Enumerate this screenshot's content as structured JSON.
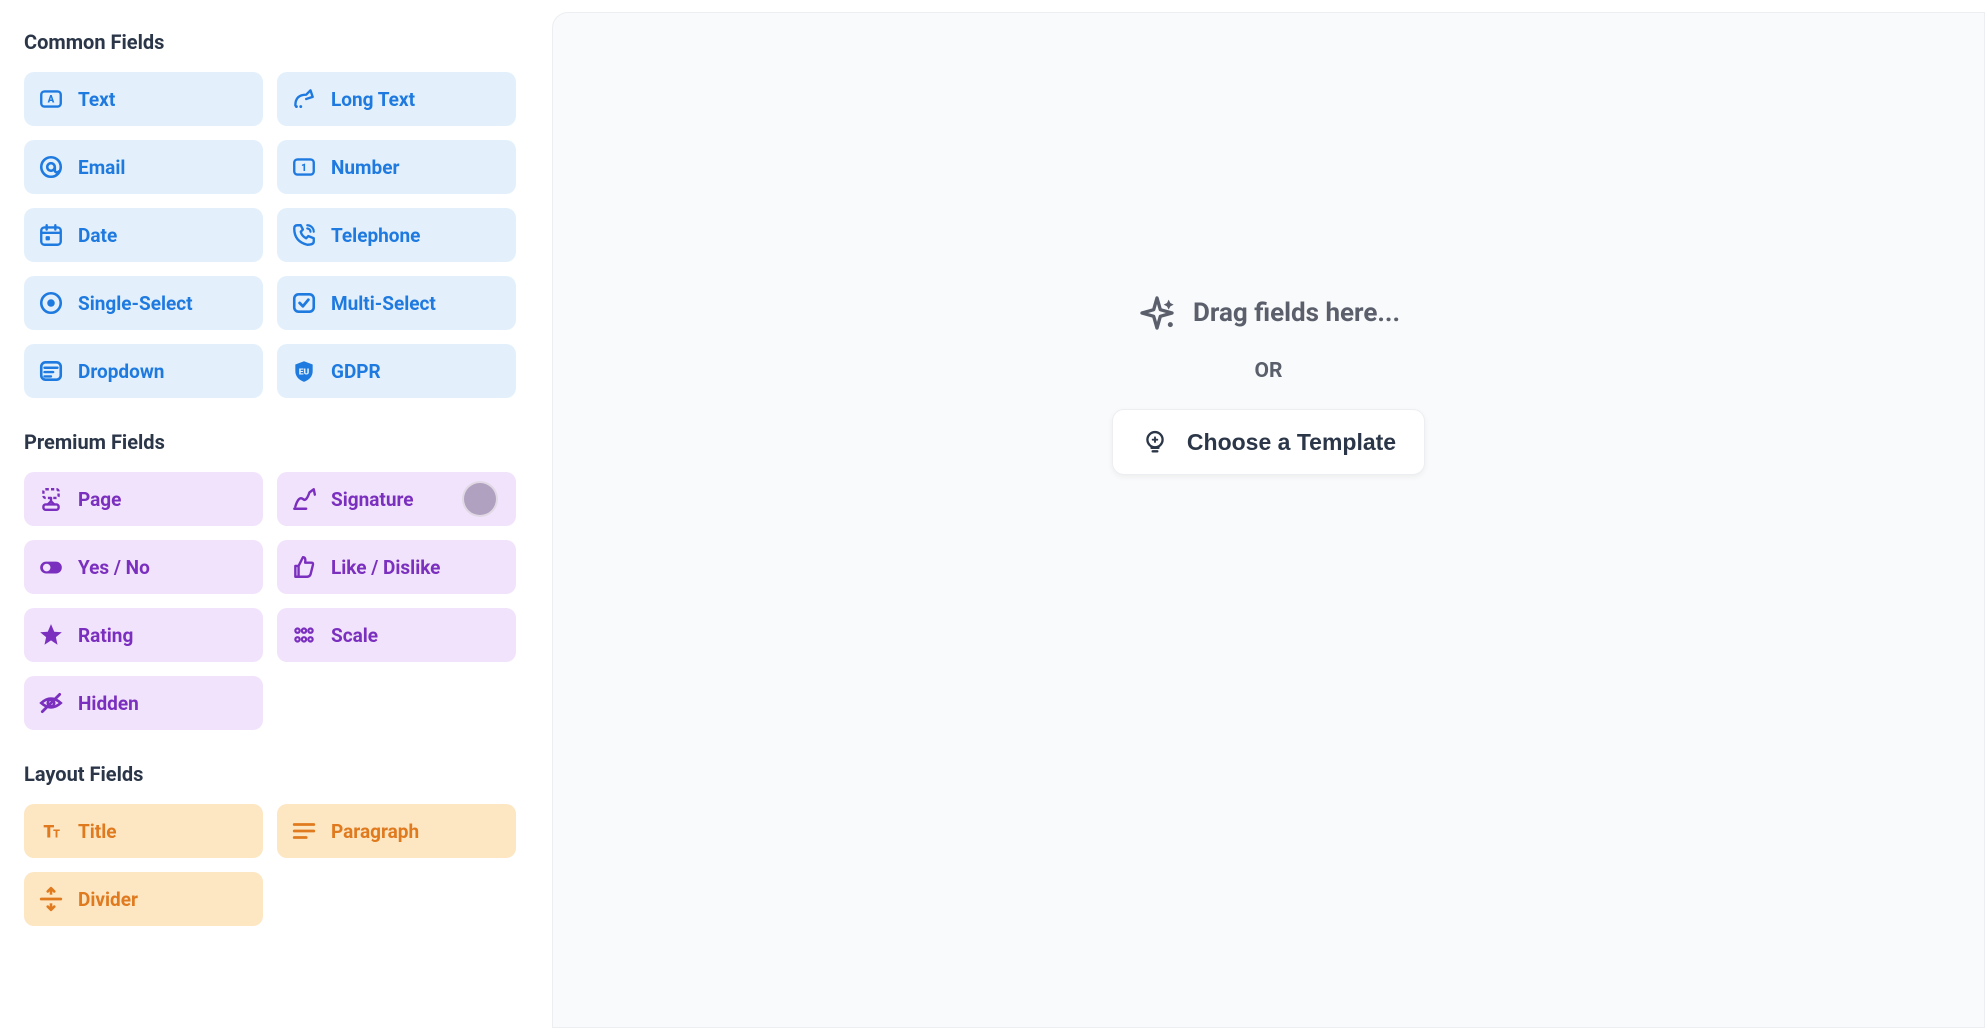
{
  "sidebar": {
    "sections": [
      {
        "title": "Common Fields",
        "group": "common",
        "items": [
          {
            "label": "Text",
            "icon": "text-icon"
          },
          {
            "label": "Long Text",
            "icon": "long-text-icon"
          },
          {
            "label": "Email",
            "icon": "email-icon"
          },
          {
            "label": "Number",
            "icon": "number-icon"
          },
          {
            "label": "Date",
            "icon": "date-icon"
          },
          {
            "label": "Telephone",
            "icon": "telephone-icon"
          },
          {
            "label": "Single-Select",
            "icon": "radio-icon"
          },
          {
            "label": "Multi-Select",
            "icon": "checkbox-icon"
          },
          {
            "label": "Dropdown",
            "icon": "dropdown-icon"
          },
          {
            "label": "GDPR",
            "icon": "gdpr-icon"
          }
        ]
      },
      {
        "title": "Premium Fields",
        "group": "premium",
        "items": [
          {
            "label": "Page",
            "icon": "page-icon"
          },
          {
            "label": "Signature",
            "icon": "signature-icon",
            "cursor": true
          },
          {
            "label": "Yes / No",
            "icon": "toggle-icon"
          },
          {
            "label": "Like / Dislike",
            "icon": "thumbs-icon"
          },
          {
            "label": "Rating",
            "icon": "star-icon"
          },
          {
            "label": "Scale",
            "icon": "scale-icon"
          },
          {
            "label": "Hidden",
            "icon": "hidden-icon"
          }
        ]
      },
      {
        "title": "Layout Fields",
        "group": "layout",
        "items": [
          {
            "label": "Title",
            "icon": "title-icon"
          },
          {
            "label": "Paragraph",
            "icon": "paragraph-icon"
          },
          {
            "label": "Divider",
            "icon": "divider-icon"
          }
        ]
      }
    ]
  },
  "canvas": {
    "drag_hint": "Drag fields here...",
    "or_label": "OR",
    "template_button": "Choose a Template"
  }
}
